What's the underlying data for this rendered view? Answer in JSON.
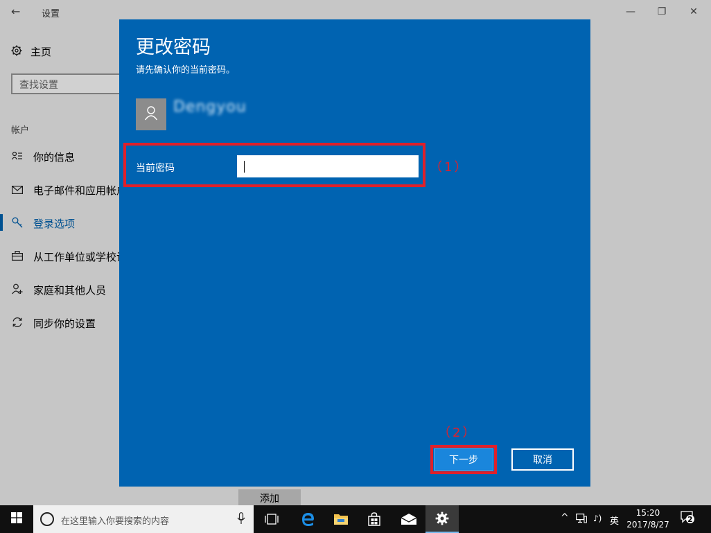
{
  "window": {
    "title": "设置",
    "back_glyph": "←",
    "minimize_glyph": "—",
    "restore_glyph": "❐",
    "close_glyph": "✕"
  },
  "sidebar": {
    "home_label": "主页",
    "search_placeholder": "查找设置",
    "section_label": "帐户",
    "items": [
      {
        "label": "你的信息",
        "icon": "person-card-icon"
      },
      {
        "label": "电子邮件和应用帐户",
        "icon": "mail-icon"
      },
      {
        "label": "登录选项",
        "icon": "key-icon",
        "active": true
      },
      {
        "label": "从工作单位或学校访问",
        "icon": "briefcase-icon"
      },
      {
        "label": "家庭和其他人员",
        "icon": "people-icon"
      },
      {
        "label": "同步你的设置",
        "icon": "sync-icon"
      }
    ]
  },
  "main": {
    "add_label": "添加"
  },
  "dialog": {
    "title": "更改密码",
    "subtitle": "请先确认你的当前密码。",
    "username": "Dengyou",
    "field_label": "当前密码",
    "password_value": "",
    "next_label": "下一步",
    "cancel_label": "取消",
    "annotation_1": "（1）",
    "annotation_2": "（2）",
    "accent_color": "#0063b1",
    "annotation_color": "#e0202a"
  },
  "taskbar": {
    "search_placeholder": "在这里输入你要搜索的内容",
    "tray_chevron": "^",
    "volume_glyph": "♪)",
    "ime_label": "英",
    "time": "15:20",
    "date": "2017/8/27",
    "notification_count": "2"
  }
}
